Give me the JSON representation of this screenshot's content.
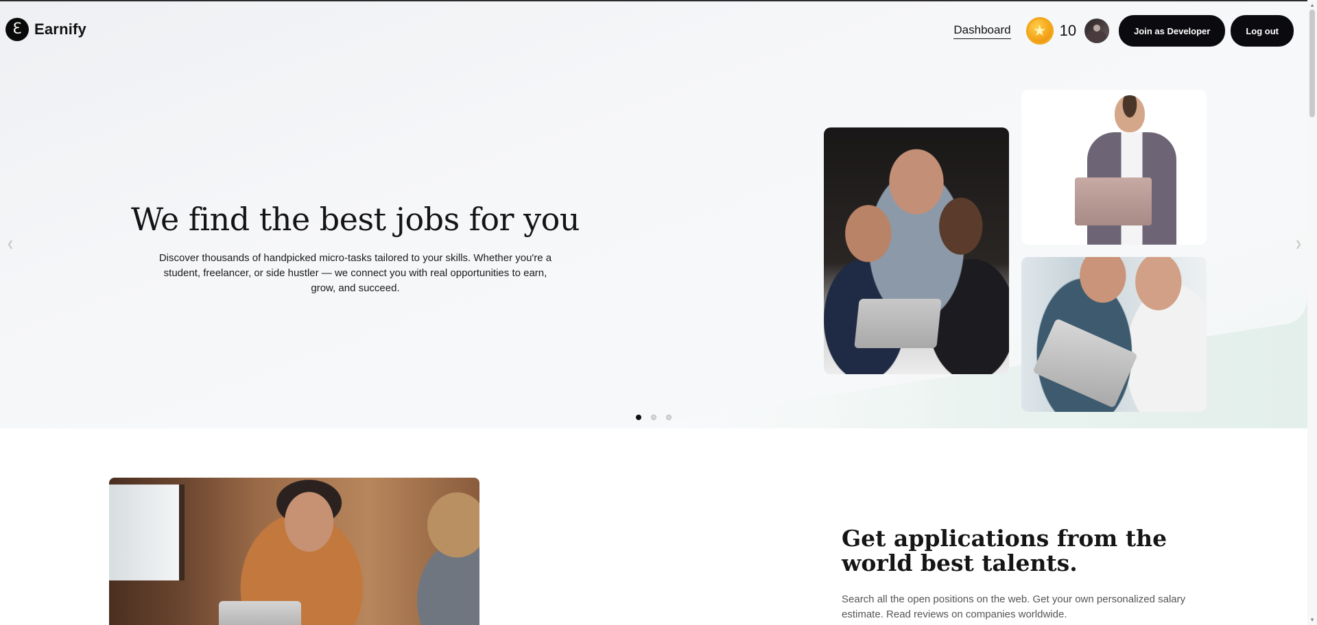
{
  "brand": {
    "name": "Earnify",
    "logo_glyph": "ℇ"
  },
  "nav": {
    "dashboard_label": "Dashboard",
    "coin_icon": "star-coin-icon",
    "coin_count": "10",
    "join_label": "Join as Developer",
    "logout_label": "Log out"
  },
  "hero": {
    "title": "We find the best jobs for you",
    "subtitle": "Discover thousands of handpicked micro-tasks tailored to your skills. Whether you're a student, freelancer, or side hustler — we connect you with real opportunities to earn, grow, and succeed.",
    "slide_count": 3,
    "active_slide": 1
  },
  "section_two": {
    "title": "Get applications from the world best talents.",
    "text": "Search all the open positions on the web. Get your own personalized salary estimate. Read reviews on companies worldwide."
  },
  "colors": {
    "primary_button": "#0b0b0f",
    "coin": "#f3a218",
    "accent_mint": "#e6f1ee"
  }
}
